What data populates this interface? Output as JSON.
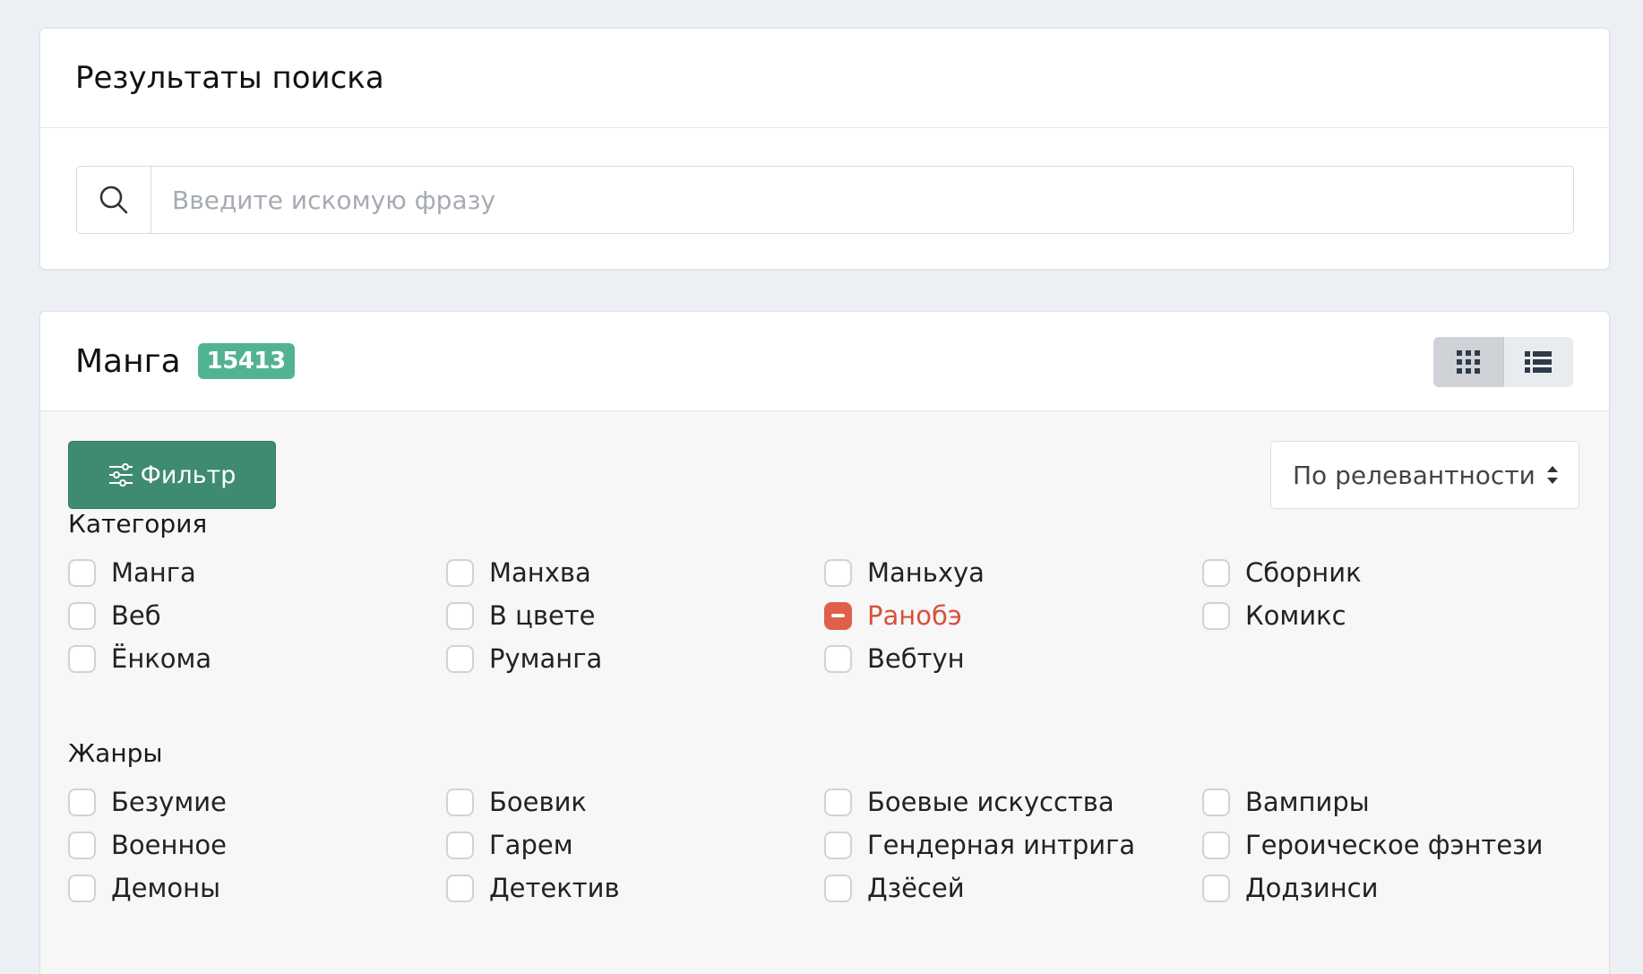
{
  "search": {
    "title": "Результаты поиска",
    "placeholder": "Введите искомую фразу",
    "value": ""
  },
  "manga": {
    "title": "Манга",
    "count": "15413",
    "view_modes": [
      {
        "name": "grid",
        "icon": "grid-icon",
        "active": true
      },
      {
        "name": "list",
        "icon": "list-icon",
        "active": false
      }
    ],
    "filter_label": "Фильтр",
    "sort_label": "По релевантности"
  },
  "categories": {
    "title": "Категория",
    "items": [
      {
        "label": "Манга",
        "state": "unchecked"
      },
      {
        "label": "Манхва",
        "state": "unchecked"
      },
      {
        "label": "Маньхуа",
        "state": "unchecked"
      },
      {
        "label": "Сборник",
        "state": "unchecked"
      },
      {
        "label": "Веб",
        "state": "unchecked"
      },
      {
        "label": "В цвете",
        "state": "unchecked"
      },
      {
        "label": "Ранобэ",
        "state": "excluded"
      },
      {
        "label": "Комикс",
        "state": "unchecked"
      },
      {
        "label": "Ёнкома",
        "state": "unchecked"
      },
      {
        "label": "Руманга",
        "state": "unchecked"
      },
      {
        "label": "Вебтун",
        "state": "unchecked"
      }
    ]
  },
  "genres": {
    "title": "Жанры",
    "items": [
      {
        "label": "Безумие",
        "state": "unchecked"
      },
      {
        "label": "Боевик",
        "state": "unchecked"
      },
      {
        "label": "Боевые искусства",
        "state": "unchecked"
      },
      {
        "label": "Вампиры",
        "state": "unchecked"
      },
      {
        "label": "Военное",
        "state": "unchecked"
      },
      {
        "label": "Гарем",
        "state": "unchecked"
      },
      {
        "label": "Гендерная интрига",
        "state": "unchecked"
      },
      {
        "label": "Героическое фэнтези",
        "state": "unchecked"
      },
      {
        "label": "Демоны",
        "state": "unchecked"
      },
      {
        "label": "Детектив",
        "state": "unchecked"
      },
      {
        "label": "Дзёсей",
        "state": "unchecked"
      },
      {
        "label": "Додзинси",
        "state": "unchecked"
      }
    ]
  },
  "colors": {
    "accent": "#3f8b71",
    "badge": "#52b393",
    "excluded": "#df5f4a"
  }
}
